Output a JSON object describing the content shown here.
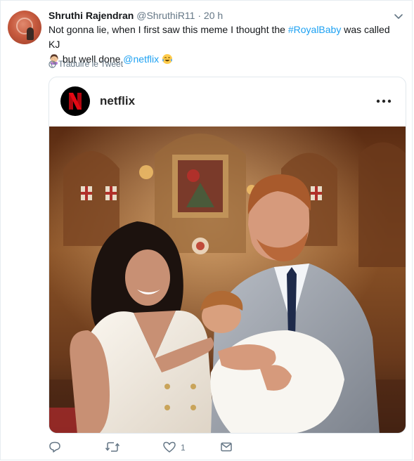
{
  "tweet": {
    "author_name": "Shruthi Rajendran",
    "handle": "@ShruthiR11",
    "separator": "·",
    "time": "20 h",
    "text_part1": "Not gonna lie, when I first saw this meme I thought the ",
    "hashtag": "#RoyalBaby",
    "text_part2": " was called KJ ",
    "text_part3": " but well done ",
    "mention": "@netflix",
    "translate_label": "Traduire le Tweet"
  },
  "card": {
    "account_name": "netflix",
    "logo_letter": "N"
  },
  "actions": {
    "like_count": "1"
  },
  "colors": {
    "link": "#1da1f2",
    "muted": "#657786",
    "netflix_red": "#e50914"
  },
  "icons": [
    "chevron-down-icon",
    "globe-icon",
    "more-options-icon",
    "reply-icon",
    "retweet-icon",
    "like-icon",
    "direct-message-icon",
    "woman-facepalming-emoji",
    "tears-of-joy-emoji"
  ]
}
